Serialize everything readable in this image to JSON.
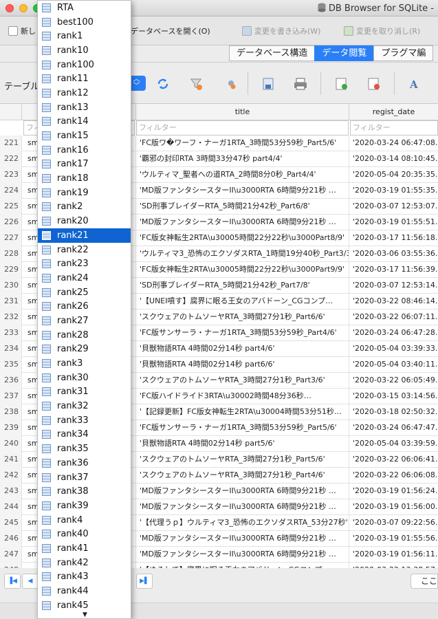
{
  "window": {
    "title": "DB Browser for SQLite -"
  },
  "toolbar": {
    "new_db_label": "新し",
    "open_db_label": "データベースを開く(O)",
    "write_changes_label": "変更を書き込み(W)",
    "revert_changes_label": "変更を取り消し(R)"
  },
  "tabs": [
    "データベース構造",
    "データ閲覧",
    "プラグマ編"
  ],
  "browse": {
    "table_label": "テーブル"
  },
  "grid": {
    "columns": {
      "title": "title",
      "regist_date": "regist_date"
    },
    "filter_placeholder": "フィルター",
    "rows": [
      {
        "num": "221",
        "col1": "sm",
        "title": "'FC版ワ�ワーフ・ナーガ1RTA_3時間53分59秒_Part5/6'",
        "date": "'2020-03-24 06:47:08.5"
      },
      {
        "num": "222",
        "col1": "sm",
        "title": "'覇邪の封印RTA 3時間33分47秒 part4/4'",
        "date": "'2020-03-14 08:10:45.8"
      },
      {
        "num": "223",
        "col1": "sm",
        "title": "'ウルティマ_聖者への道RTA_2時間8分0秒_Part4/4'",
        "date": "'2020-05-04 20:35:35.3"
      },
      {
        "num": "224",
        "col1": "sm",
        "title": "'MD版ファンタシースターII\\u3000RTA 6時間9分21秒 …",
        "date": "'2020-03-19 01:55:35.9"
      },
      {
        "num": "225",
        "col1": "sm",
        "title": "'SD刑事ブレイダーRTA_5時間21分42秒_Part6/8'",
        "date": "'2020-03-07 12:53:07.1"
      },
      {
        "num": "226",
        "col1": "sm",
        "title": "'MD版ファンタシースターII\\u3000RTA 6時間9分21秒 …",
        "date": "'2020-03-19 01:55:51.8"
      },
      {
        "num": "227",
        "col1": "sm",
        "title": "'FC版女神転生2RTA\\u30005時間22分22秒\\u3000Part8/9'",
        "date": "'2020-03-17 11:56:18.2"
      },
      {
        "num": "228",
        "col1": "sm",
        "title": "'ウルティマ3_恐怖のエクソダスRTA_1時間19分40秒_Part3/3'",
        "date": "'2020-03-06 03:55:36.7"
      },
      {
        "num": "229",
        "col1": "sm",
        "title": "'FC版女神転生2RTA\\u30005時間22分22秒\\u3000Part9/9'",
        "date": "'2020-03-17 11:56:39.3"
      },
      {
        "num": "230",
        "col1": "sm",
        "title": "'SD刑事ブレイダーRTA_5時間21分42秒_Part7/8'",
        "date": "'2020-03-07 12:53:14.9"
      },
      {
        "num": "231",
        "col1": "sm",
        "title": "'【UNEI噴す】腐界に眠る王女のアバドーン_CGコンプ…",
        "date": "'2020-03-22 08:46:14.0"
      },
      {
        "num": "232",
        "col1": "sm",
        "title": "'スクウェアのトムソーヤRTA_3時間27分1秒_Part6/6'",
        "date": "'2020-03-22 06:07:11.8"
      },
      {
        "num": "233",
        "col1": "sm",
        "title": "'FC版サンサーラ・ナーガ1RTA_3時間53分59秒_Part4/6'",
        "date": "'2020-03-24 06:47:28.8"
      },
      {
        "num": "234",
        "col1": "sm",
        "title": "'貝獣物語RTA 4時間02分14秒 part4/6'",
        "date": "'2020-05-04 03:39:33.5"
      },
      {
        "num": "235",
        "col1": "sm",
        "title": "'貝獣物語RTA 4時間02分14秒 part6/6'",
        "date": "'2020-05-04 03:40:11.2"
      },
      {
        "num": "236",
        "col1": "sm",
        "title": "'スクウェアのトムソーヤRTA_3時間27分1秒_Part3/6'",
        "date": "'2020-03-22 06:05:49.9"
      },
      {
        "num": "237",
        "col1": "sm",
        "title": "'FC版ハイドライド3RTA\\u30002時間48分36秒…",
        "date": "'2020-03-15 03:14:56.6"
      },
      {
        "num": "238",
        "col1": "sm",
        "title": "'【記録更新】FC版女神転生2RTA\\u30004時間53分51秒…",
        "date": "'2020-03-18 02:50:32.9"
      },
      {
        "num": "239",
        "col1": "sm",
        "title": "'FC版サンサーラ・ナーガ1RTA_3時間53分59秒_Part5/6'",
        "date": "'2020-03-24 06:47:47.7"
      },
      {
        "num": "240",
        "col1": "sm",
        "title": "'貝獣物語RTA 4時間02分14秒 part5/6'",
        "date": "'2020-05-04 03:39:59.8"
      },
      {
        "num": "241",
        "col1": "sm",
        "title": "'スクウェアのトムソーヤRTA_3時間27分1秒_Part5/6'",
        "date": "'2020-03-22 06:06:41.7"
      },
      {
        "num": "242",
        "col1": "sm",
        "title": "'スクウェアのトムソーヤRTA_3時間27分1秒_Part4/6'",
        "date": "'2020-03-22 06:06:08.5"
      },
      {
        "num": "243",
        "col1": "sm",
        "title": "'MD版ファンタシースターII\\u3000RTA 6時間9分21秒 …",
        "date": "'2020-03-19 01:56:24.3"
      },
      {
        "num": "244",
        "col1": "sm",
        "title": "'MD版ファンタシースターII\\u3000RTA 6時間9分21秒 …",
        "date": "'2020-03-19 01:56:00.7"
      },
      {
        "num": "245",
        "col1": "sm",
        "title": "'【代理うｐ】ウルティマ3_恐怖のエクソダスRTA_53分27秒'",
        "date": "'2020-03-07 09:22:56.8"
      },
      {
        "num": "246",
        "col1": "sm",
        "title": "'MD版ファンタシースターII\\u3000RTA 6時間9分21秒 …",
        "date": "'2020-03-19 01:55:56.8"
      },
      {
        "num": "247",
        "col1": "sm",
        "title": "'MD版ファンタシースターII\\u3000RTA 6時間9分21秒 …",
        "date": "'2020-03-19 01:56:11.3"
      },
      {
        "num": "248",
        "col1": "sm",
        "title": "'【ゆるして】腐界に眠る王女のアバドーン_CGコンプ…",
        "date": "'2020-03-22 13:38:57.8"
      }
    ]
  },
  "bottom": {
    "goto_label": "ここ"
  },
  "dropdown": {
    "selected": "rank21",
    "items": [
      "RTA",
      "best100",
      "rank1",
      "rank10",
      "rank100",
      "rank11",
      "rank12",
      "rank13",
      "rank14",
      "rank15",
      "rank16",
      "rank17",
      "rank18",
      "rank19",
      "rank2",
      "rank20",
      "rank21",
      "rank22",
      "rank23",
      "rank24",
      "rank25",
      "rank26",
      "rank27",
      "rank28",
      "rank29",
      "rank3",
      "rank30",
      "rank31",
      "rank32",
      "rank33",
      "rank34",
      "rank35",
      "rank36",
      "rank37",
      "rank38",
      "rank39",
      "rank4",
      "rank40",
      "rank41",
      "rank42",
      "rank43",
      "rank44",
      "rank45"
    ]
  },
  "colors": {
    "accent": "#2a7ff6",
    "selection": "#0f64d2"
  }
}
